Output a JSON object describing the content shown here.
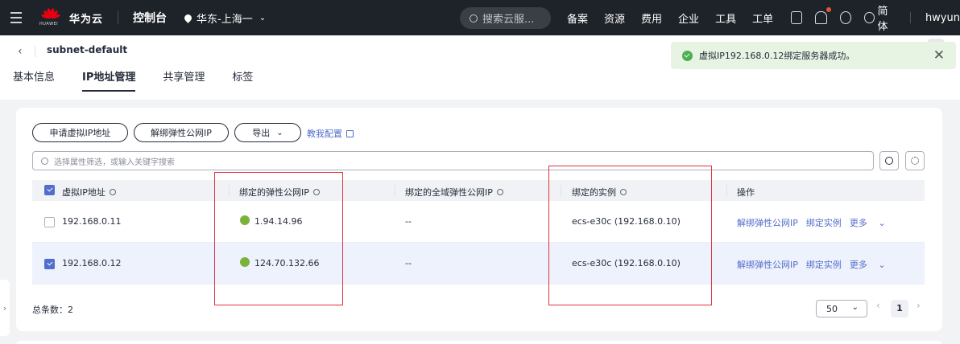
{
  "topnav": {
    "brand": "华为云",
    "logo_sub": "HUAWEI",
    "console": "控制台",
    "region": "华东-上海一",
    "search_placeholder": "搜索云服...",
    "items": [
      "备案",
      "资源",
      "费用",
      "企业",
      "工具",
      "工单"
    ],
    "lang": "简体",
    "user": "hwyun"
  },
  "header": {
    "subnet": "subnet-default",
    "tabs": [
      "基本信息",
      "IP地址管理",
      "共享管理",
      "标签"
    ],
    "active_tab": 1
  },
  "toast": {
    "message": "虚拟IP192.168.0.12绑定服务器成功。",
    "color": "#e8f4e3"
  },
  "toolbar": {
    "apply_vip": "申请虚拟IP地址",
    "unbind_eip": "解绑弹性公网IP",
    "export": "导出",
    "tutorial": "教我配置"
  },
  "filter": {
    "placeholder": "选择属性筛选，或输入关键字搜索"
  },
  "table": {
    "columns": [
      "虚拟IP地址",
      "绑定的弹性公网IP",
      "绑定的全域弹性公网IP",
      "绑定的实例",
      "操作"
    ],
    "rows": [
      {
        "vip": "192.168.0.11",
        "eip": "1.94.14.96",
        "global_eip": "--",
        "instance": "ecs-e30c   (192.168.0.10)",
        "selected": false
      },
      {
        "vip": "192.168.0.12",
        "eip": "124.70.132.66",
        "global_eip": "--",
        "instance": "ecs-e30c   (192.168.0.10)",
        "selected": true
      }
    ],
    "ops": [
      "解绑弹性公网IP",
      "绑定实例",
      "更多"
    ]
  },
  "footer": {
    "total": "总条数：2",
    "page_size": "50",
    "current_page": "1"
  },
  "colors": {
    "accent": "#526ecc",
    "highlight_box": "#e0323c",
    "nav_bg": "#1e2329"
  }
}
